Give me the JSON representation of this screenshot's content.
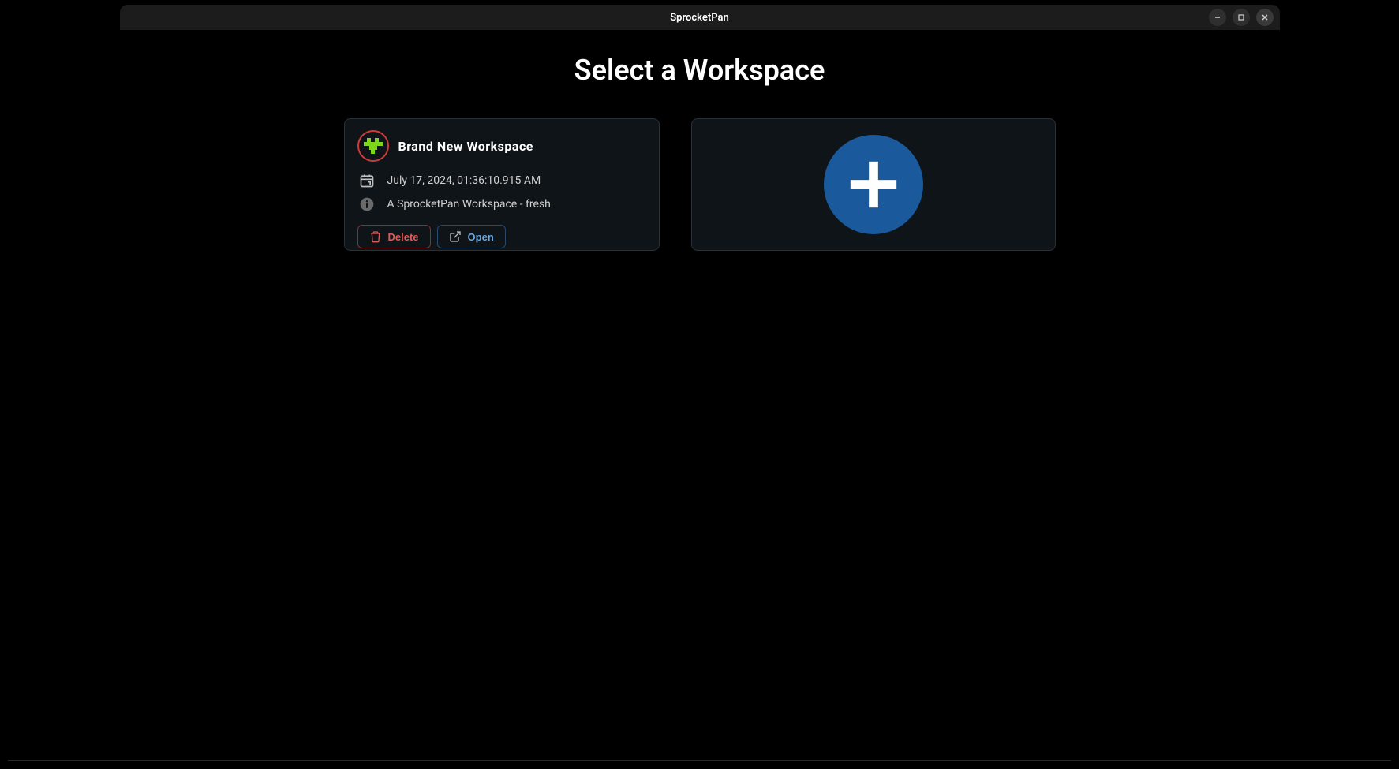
{
  "titlebar": {
    "title": "SprocketPan"
  },
  "page": {
    "heading": "Select a Workspace"
  },
  "workspace": {
    "name": "Brand New Workspace",
    "modified": "July 17, 2024, 01:36:10.915 AM",
    "description": "A SprocketPan Workspace - fresh",
    "delete_label": "Delete",
    "open_label": "Open"
  }
}
